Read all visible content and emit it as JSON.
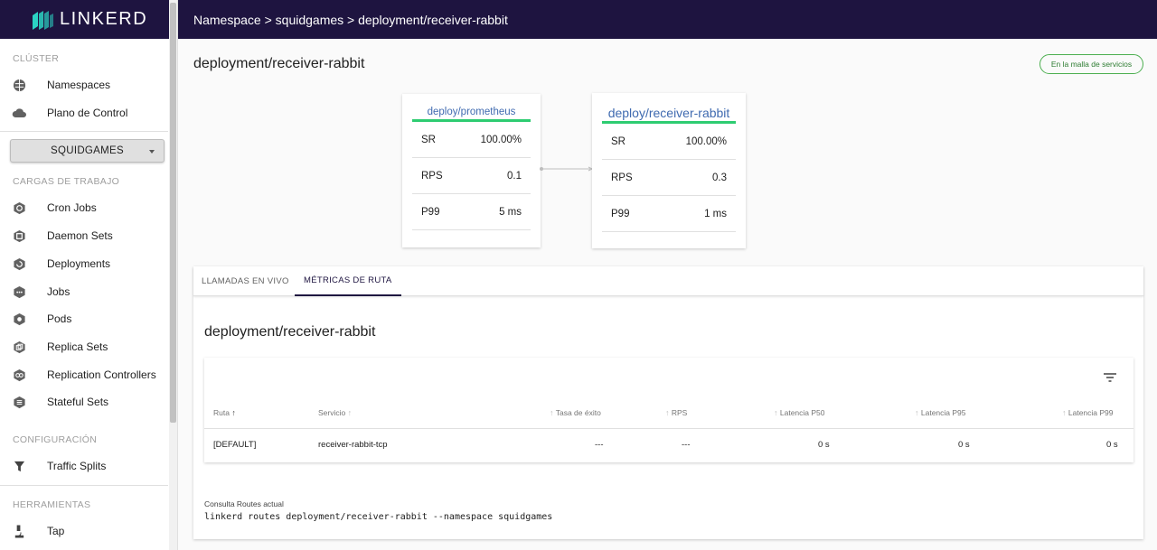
{
  "app": {
    "logo_text": "LINKERD"
  },
  "sidebar": {
    "cluster_title": "CLÚSTER",
    "cluster_items": [
      {
        "label": "Namespaces",
        "icon": "namespaces-icon"
      },
      {
        "label": "Plano de Control",
        "icon": "cloud-icon"
      }
    ],
    "namespace_select": "SQUIDGAMES",
    "workloads_title": "CARGAS DE TRABAJO",
    "workload_items": [
      {
        "label": "Cron Jobs",
        "icon": "cron-jobs-icon"
      },
      {
        "label": "Daemon Sets",
        "icon": "daemon-sets-icon"
      },
      {
        "label": "Deployments",
        "icon": "deployments-icon"
      },
      {
        "label": "Jobs",
        "icon": "jobs-icon"
      },
      {
        "label": "Pods",
        "icon": "pods-icon"
      },
      {
        "label": "Replica Sets",
        "icon": "replica-sets-icon"
      },
      {
        "label": "Replication Controllers",
        "icon": "replication-controllers-icon"
      },
      {
        "label": "Stateful Sets",
        "icon": "stateful-sets-icon"
      }
    ],
    "config_title": "CONFIGURACIÓN",
    "config_items": [
      {
        "label": "Traffic Splits",
        "icon": "filter-icon"
      }
    ],
    "tools_title": "HERRAMIENTAS",
    "tools_items": [
      {
        "label": "Tap",
        "icon": "microscope-icon"
      }
    ]
  },
  "header": {
    "breadcrumb": "Namespace > squidgames > deployment/receiver-rabbit"
  },
  "main": {
    "title": "deployment/receiver-rabbit",
    "mesh_badge": "En la malla de servicios",
    "source_card": {
      "name": "deploy/prometheus",
      "metrics": [
        {
          "label": "SR",
          "value": "100.00%"
        },
        {
          "label": "RPS",
          "value": "0.1"
        },
        {
          "label": "P99",
          "value": "5 ms"
        }
      ]
    },
    "target_card": {
      "name": "deploy/receiver-rabbit",
      "metrics": [
        {
          "label": "SR",
          "value": "100.00%"
        },
        {
          "label": "RPS",
          "value": "0.3"
        },
        {
          "label": "P99",
          "value": "1 ms"
        }
      ]
    },
    "tabs": [
      {
        "label": "LLAMADAS EN VIVO",
        "active": false
      },
      {
        "label": "MÉTRICAS DE RUTA",
        "active": true
      }
    ],
    "section_title": "deployment/receiver-rabbit",
    "table": {
      "columns": [
        "Ruta",
        "Servicio",
        "Tasa de éxito",
        "RPS",
        "Latencia P50",
        "Latencia P95",
        "Latencia P99"
      ],
      "rows": [
        [
          "[DEFAULT]",
          "receiver-rabbit-tcp",
          "---",
          "---",
          "0 s",
          "0 s",
          "0 s"
        ]
      ]
    },
    "query_label": "Consulta Routes actual",
    "query_command": "linkerd routes deployment/receiver-rabbit --namespace squidgames"
  },
  "colors": {
    "topbar": "#1e1440",
    "accent_green": "#2ecc71",
    "link_blue": "#3f6ab0"
  }
}
